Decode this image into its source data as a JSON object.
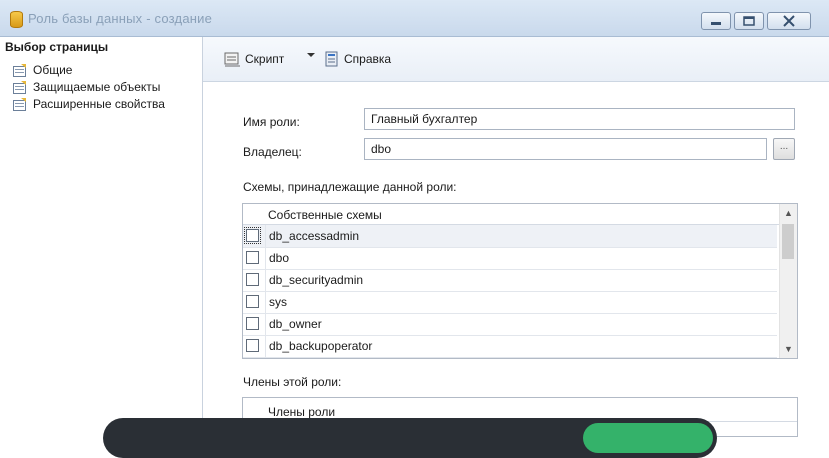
{
  "window": {
    "title": "Роль базы данных - создание",
    "icon": "database-cylinder-icon",
    "controls": [
      "minimize-icon",
      "maximize-icon",
      "close-icon"
    ]
  },
  "left_pane": {
    "header": "Выбор страницы",
    "items": [
      {
        "label": "Общие",
        "icon": "page-icon"
      },
      {
        "label": "Защищаемые объекты",
        "icon": "page-icon"
      },
      {
        "label": "Расширенные свойства",
        "icon": "page-icon"
      }
    ]
  },
  "toolbar": {
    "script_label": "Скрипт",
    "help_label": "Справка"
  },
  "form": {
    "role_name_label": "Имя роли:",
    "role_name_value": "Главный бухгалтер",
    "owner_label": "Владелец:",
    "owner_value": "dbo",
    "browse_label": "...",
    "schemas_section_label": "Схемы, принадлежащие данной роли:",
    "schemas_column_header": "Собственные схемы",
    "schemas": [
      {
        "name": "db_accessadmin",
        "checked": false
      },
      {
        "name": "dbo",
        "checked": false
      },
      {
        "name": "db_securityadmin",
        "checked": false
      },
      {
        "name": "sys",
        "checked": false
      },
      {
        "name": "db_owner",
        "checked": false
      },
      {
        "name": "db_backupoperator",
        "checked": false
      }
    ],
    "members_section_label": "Члены этой роли:",
    "members_column_header": "Члены роли"
  },
  "colors": {
    "titlebar": "#c9d9ec",
    "overlay": "#2a2f35",
    "overlay_button": "#34b26a"
  }
}
